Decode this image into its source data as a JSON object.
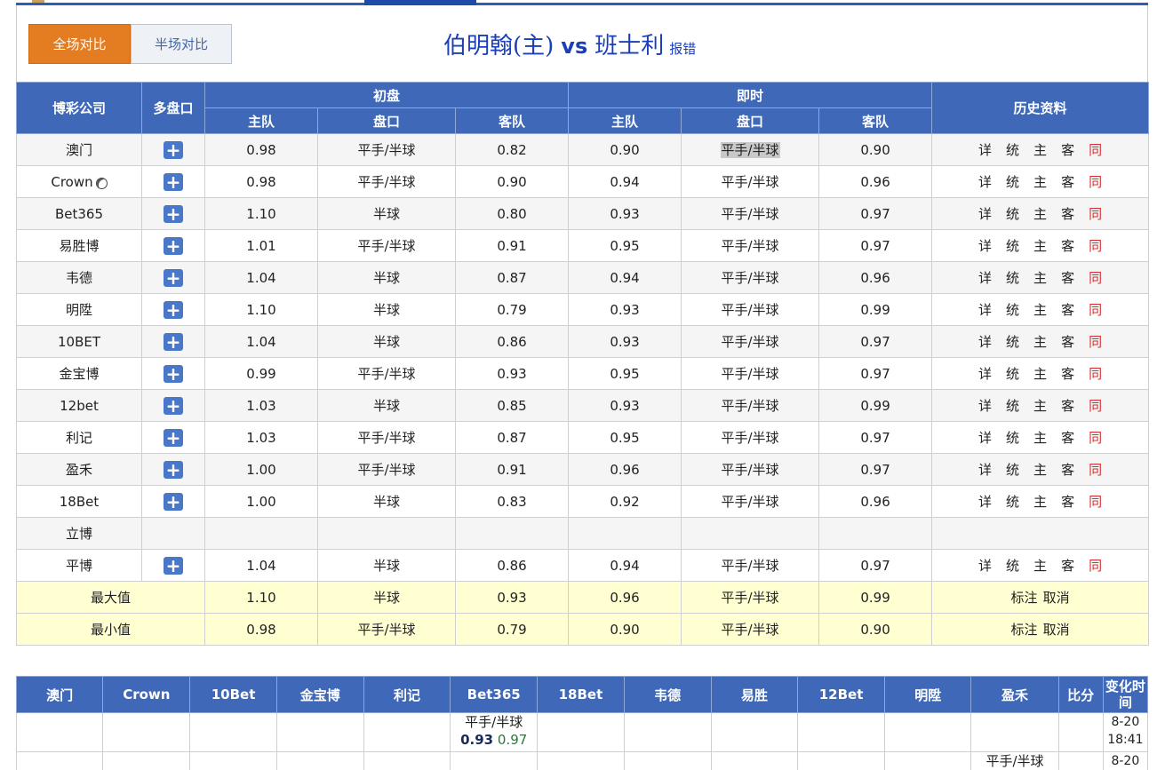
{
  "tabs": {
    "full": "全场对比",
    "half": "半场对比"
  },
  "match": {
    "home": "伯明翰(主)",
    "vs": "vs",
    "away": "班士利",
    "report": "报错"
  },
  "table": {
    "headers": {
      "company": "博彩公司",
      "multi": "多盘口",
      "initial": "初盘",
      "live": "即时",
      "history": "历史资料",
      "home": "主队",
      "line": "盘口",
      "away": "客队"
    },
    "rows": [
      {
        "name": "澳门",
        "ball": false,
        "plus": true,
        "init": [
          "0.98",
          "平手/半球",
          "0.82"
        ],
        "live": [
          "0.90",
          "平手/半球",
          "0.90"
        ],
        "highlight": true,
        "links": true
      },
      {
        "name": "Crown",
        "ball": true,
        "plus": true,
        "init": [
          "0.98",
          "平手/半球",
          "0.90"
        ],
        "live": [
          "0.94",
          "平手/半球",
          "0.96"
        ],
        "links": true
      },
      {
        "name": "Bet365",
        "plus": true,
        "init": [
          "1.10",
          "半球",
          "0.80"
        ],
        "live": [
          "0.93",
          "平手/半球",
          "0.97"
        ],
        "links": true
      },
      {
        "name": "易胜博",
        "plus": true,
        "init": [
          "1.01",
          "平手/半球",
          "0.91"
        ],
        "live": [
          "0.95",
          "平手/半球",
          "0.97"
        ],
        "links": true
      },
      {
        "name": "韦德",
        "plus": true,
        "init": [
          "1.04",
          "半球",
          "0.87"
        ],
        "live": [
          "0.94",
          "平手/半球",
          "0.96"
        ],
        "links": true
      },
      {
        "name": "明陞",
        "plus": true,
        "init": [
          "1.10",
          "半球",
          "0.79"
        ],
        "live": [
          "0.93",
          "平手/半球",
          "0.99"
        ],
        "links": true
      },
      {
        "name": "10BET",
        "plus": true,
        "init": [
          "1.04",
          "半球",
          "0.86"
        ],
        "live": [
          "0.93",
          "平手/半球",
          "0.97"
        ],
        "links": true
      },
      {
        "name": "金宝博",
        "plus": true,
        "init": [
          "0.99",
          "平手/半球",
          "0.93"
        ],
        "live": [
          "0.95",
          "平手/半球",
          "0.97"
        ],
        "links": true
      },
      {
        "name": "12bet",
        "plus": true,
        "init": [
          "1.03",
          "半球",
          "0.85"
        ],
        "live": [
          "0.93",
          "平手/半球",
          "0.99"
        ],
        "links": true
      },
      {
        "name": "利记",
        "plus": true,
        "init": [
          "1.03",
          "平手/半球",
          "0.87"
        ],
        "live": [
          "0.95",
          "平手/半球",
          "0.97"
        ],
        "links": true
      },
      {
        "name": "盈禾",
        "plus": true,
        "init": [
          "1.00",
          "平手/半球",
          "0.91"
        ],
        "live": [
          "0.96",
          "平手/半球",
          "0.97"
        ],
        "links": true
      },
      {
        "name": "18Bet",
        "plus": true,
        "init": [
          "1.00",
          "半球",
          "0.83"
        ],
        "live": [
          "0.92",
          "平手/半球",
          "0.96"
        ],
        "links": true
      },
      {
        "name": "立博",
        "plus": false,
        "init": [
          "",
          "",
          ""
        ],
        "live": [
          "",
          "",
          ""
        ],
        "links": false
      },
      {
        "name": "平博",
        "plus": true,
        "init": [
          "1.04",
          "半球",
          "0.86"
        ],
        "live": [
          "0.94",
          "平手/半球",
          "0.97"
        ],
        "links": true
      }
    ],
    "links": [
      "详",
      "统",
      "主",
      "客",
      "同"
    ],
    "max": {
      "label": "最大值",
      "init": [
        "1.10",
        "半球",
        "0.93"
      ],
      "live": [
        "0.96",
        "平手/半球",
        "0.99"
      ]
    },
    "min": {
      "label": "最小值",
      "init": [
        "0.98",
        "平手/半球",
        "0.79"
      ],
      "live": [
        "0.90",
        "平手/半球",
        "0.90"
      ]
    },
    "stat_actions": [
      "标注",
      "取消"
    ]
  },
  "changes": {
    "headers": [
      "澳门",
      "Crown",
      "10Bet",
      "金宝博",
      "利记",
      "Bet365",
      "18Bet",
      "韦德",
      "易胜",
      "12Bet",
      "明陞",
      "盈禾",
      "比分",
      "变化时间"
    ],
    "row1": {
      "bet365_line": "平手/半球",
      "bet365_home": "0.93",
      "bet365_away": "0.97",
      "time_date": "8-20",
      "time_clock": "18:41"
    },
    "row2": {
      "yinghe_line": "平手/半球",
      "time_date": "8-20"
    }
  },
  "colors": {
    "header_blue": "#3f68b8",
    "tab_orange": "#e47c22",
    "title_blue": "#1a3fb8",
    "link_red": "#d03030",
    "stat_yellow": "#ffffd2"
  }
}
